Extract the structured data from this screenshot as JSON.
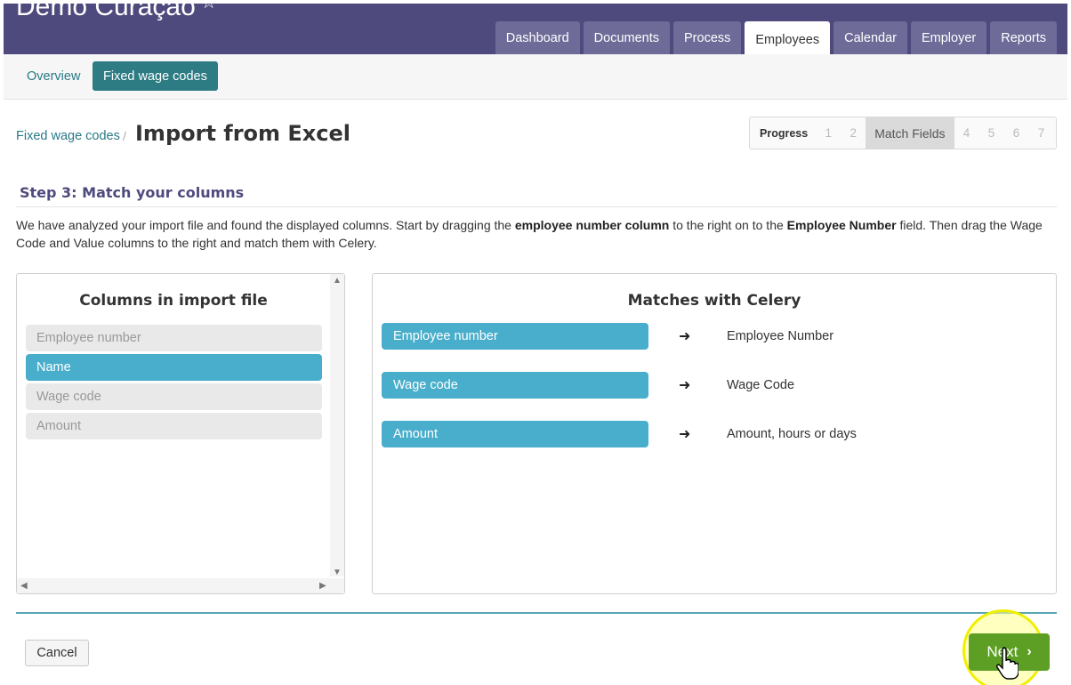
{
  "header": {
    "company": "Demo Curaçao",
    "company_star": "☆",
    "tabs": [
      {
        "label": "Dashboard"
      },
      {
        "label": "Documents"
      },
      {
        "label": "Process"
      },
      {
        "label": "Employees",
        "active": true
      },
      {
        "label": "Calendar"
      },
      {
        "label": "Employer"
      },
      {
        "label": "Reports"
      }
    ]
  },
  "subnav": {
    "overview": "Overview",
    "fixed_wage_codes": "Fixed wage codes"
  },
  "breadcrumb": {
    "parent": "Fixed wage codes",
    "separator": "/",
    "title": "Import from Excel"
  },
  "progress": {
    "label": "Progress",
    "steps": [
      "1",
      "2",
      "Match Fields",
      "4",
      "5",
      "6",
      "7"
    ],
    "current": "Match Fields"
  },
  "step": {
    "title": "Step 3: Match your columns",
    "instructions_1": "We have analyzed your import file and found the displayed columns. Start by dragging the ",
    "instructions_bold_1": "employee number column",
    "instructions_2": " to the right on to the ",
    "instructions_bold_2": "Employee Number",
    "instructions_3": " field. Then drag the Wage Code and Value columns to the right and match them with Celery."
  },
  "import_columns": {
    "heading": "Columns in import file",
    "items": [
      {
        "label": "Employee number",
        "selected": false
      },
      {
        "label": "Name",
        "selected": true
      },
      {
        "label": "Wage code",
        "selected": false
      },
      {
        "label": "Amount",
        "selected": false
      }
    ]
  },
  "matches": {
    "heading": "Matches with Celery",
    "arrow": "➜",
    "rows": [
      {
        "source": "Employee number",
        "target": "Employee Number"
      },
      {
        "source": "Wage code",
        "target": "Wage Code"
      },
      {
        "source": "Amount",
        "target": "Amount, hours or days"
      }
    ]
  },
  "footer": {
    "cancel": "Cancel",
    "next": "Next",
    "next_chevron": "›"
  },
  "colors": {
    "header_bg": "#4e4a7d",
    "tab_bg": "#6e6b98",
    "teal": "#2d7b83",
    "chip": "#49aecb",
    "next_green": "#5c9f24",
    "highlight": "#f0ef00"
  }
}
